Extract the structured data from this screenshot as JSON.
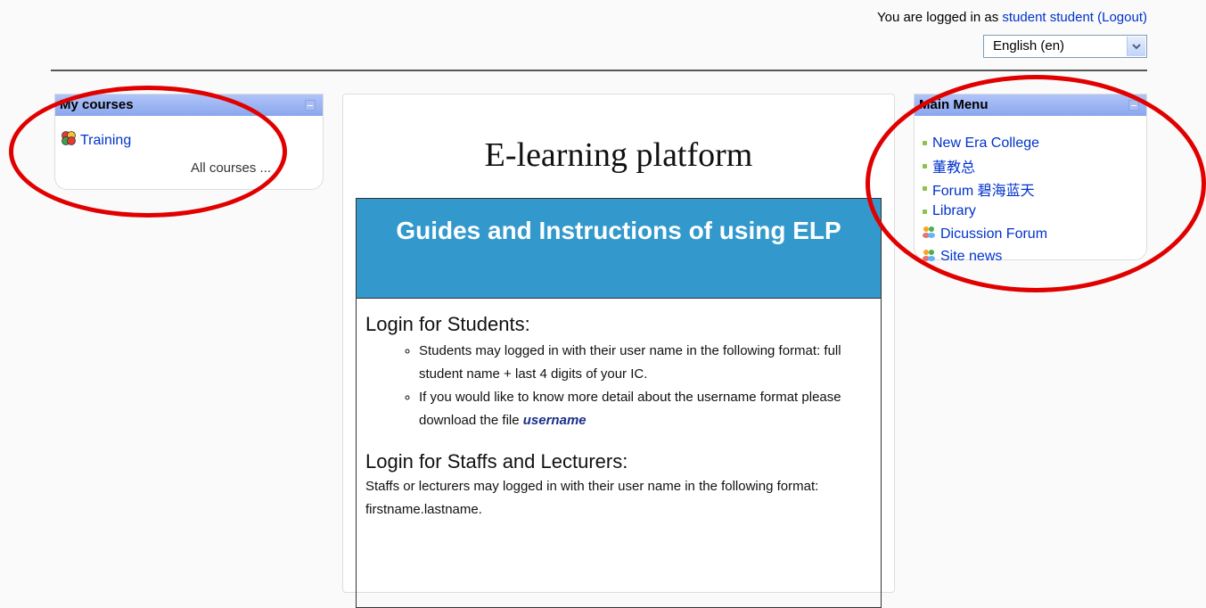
{
  "header": {
    "login_prefix": "You are logged in as ",
    "user_name": "student student",
    "logout_label": "(Logout)",
    "language_selected": "English (en)"
  },
  "my_courses": {
    "title": "My courses",
    "course_label": "Training",
    "all_courses_label": "All courses ..."
  },
  "main_menu": {
    "title": "Main Menu",
    "items": [
      {
        "label": "New Era College",
        "icon": "bullet"
      },
      {
        "label": "董教总",
        "icon": "bullet"
      },
      {
        "label": "Forum 碧海蓝天",
        "icon": "bullet"
      },
      {
        "label": "Library",
        "icon": "bullet"
      },
      {
        "label": "Dicussion Forum",
        "icon": "forum-icon"
      },
      {
        "label": "Site news",
        "icon": "forum-icon"
      }
    ]
  },
  "center": {
    "site_title": "E-learning platform",
    "guide_title": "Guides and Instructions of using ELP",
    "students_heading": "Login for Students:",
    "student_bullets": [
      "Students may logged in with their user name in the following format: full student name + last 4 digits of your IC.",
      "If you would like to know more detail about the username format please download the file "
    ],
    "username_link": "username",
    "staff_heading": "Login for Staffs and Lecturers:",
    "staff_text": "Staffs or lecturers may logged in with their user name in the following format: firstname.lastname."
  },
  "colors": {
    "annotation_red": "#e10000",
    "block_header_blue": "#8aa6ee",
    "guide_header_blue": "#3399cc",
    "link_blue": "#0033cc"
  }
}
